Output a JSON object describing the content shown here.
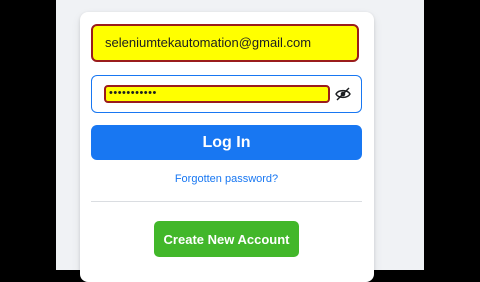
{
  "login_form": {
    "email_value": "seleniumtekautomation@gmail.com",
    "password_value": "•••••••••••",
    "show_password_icon": "eye-icon",
    "login_label": "Log In",
    "forgot_password_label": "Forgotten password?",
    "create_account_label": "Create New Account"
  },
  "colors": {
    "primary_blue": "#1877f2",
    "green": "#42b72a",
    "highlight_yellow": "#ffff00",
    "highlight_border": "#9a1c1c",
    "page_background": "#f0f2f5"
  }
}
